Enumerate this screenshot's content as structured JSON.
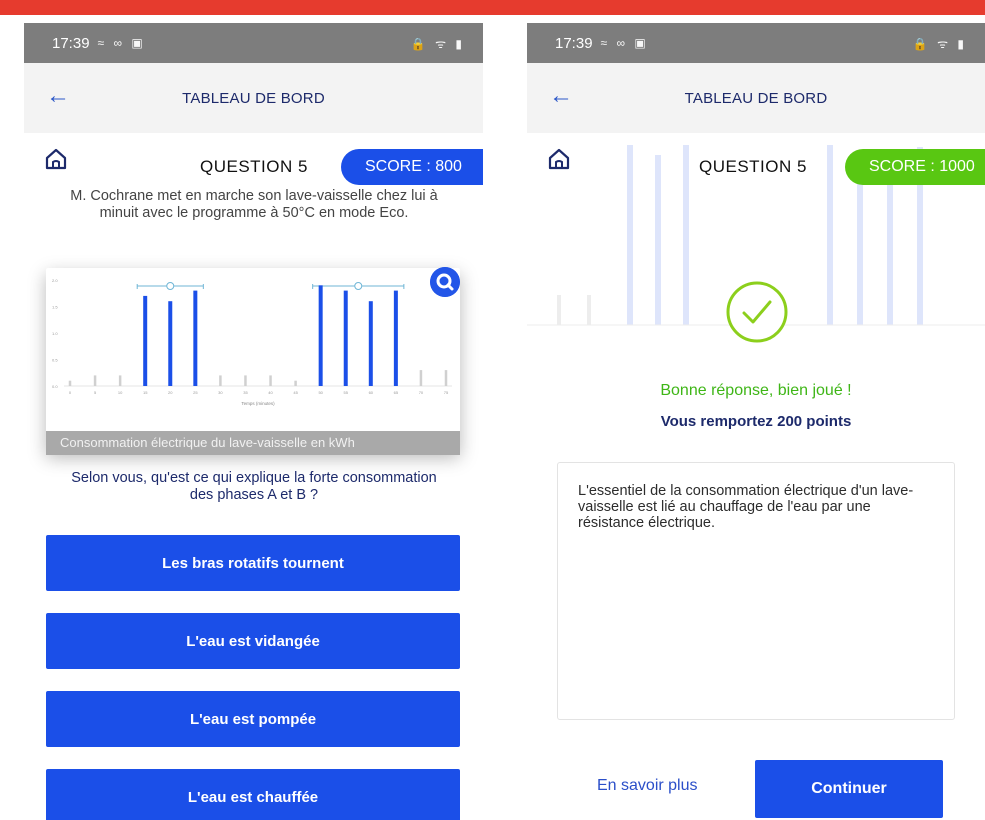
{
  "colors": {
    "top_bar": "#e63b2e",
    "primary": "#1b4fe8",
    "success": "#59c712",
    "title": "#1d2a6b"
  },
  "left": {
    "status": {
      "time": "17:39",
      "left_icons": "≈ ∞ ▣",
      "right_icons": "🔒 ᯤ ▮"
    },
    "appbar": {
      "title": "TABLEAU DE BORD",
      "back_icon": "arrow-left-icon"
    },
    "question_label": "QUESTION 5",
    "score": "SCORE : 800",
    "question_text": "M. Cochrane met en marche son lave-vaisselle chez lui à minuit avec le programme à 50°C en mode Eco.",
    "chart_caption": "Consommation électrique du lave-vaisselle en kWh",
    "prompt": "Selon vous, qu'est ce qui explique la forte consommation des phases A et B ?",
    "answers": [
      "Les bras rotatifs tournent",
      "L'eau est vidangée",
      "L'eau est pompée",
      "L'eau est chauffée"
    ]
  },
  "right": {
    "status": {
      "time": "17:39",
      "left_icons": "≈ ∞ ▣",
      "right_icons": "🔒 ᯤ ▮"
    },
    "appbar": {
      "title": "TABLEAU DE BORD",
      "back_icon": "arrow-left-icon"
    },
    "question_label": "QUESTION 5",
    "score": "SCORE : 1000",
    "feedback_title": "Bonne réponse, bien joué  !",
    "feedback_points": "Vous remportez 200 points",
    "explanation": "L'essentiel de la consommation électrique d'un lave-vaisselle est lié au chauffage de l'eau par une résistance électrique.",
    "learn_more": "En savoir plus",
    "continue": "Continuer"
  },
  "chart_data": {
    "type": "bar",
    "title": "Consommation électrique du lave-vaisselle en kWh",
    "xlabel": "Temps (minutes)",
    "ylabel": "",
    "categories": [
      "0",
      "5",
      "10",
      "15",
      "20",
      "25",
      "30",
      "35",
      "40",
      "45",
      "50",
      "55",
      "60",
      "65",
      "70",
      "75"
    ],
    "values": [
      0.1,
      0.2,
      0.2,
      1.7,
      1.6,
      1.8,
      0.2,
      0.2,
      0.2,
      0.1,
      1.9,
      1.8,
      1.6,
      1.8,
      0.3,
      0.3
    ],
    "ylim": [
      0,
      2.0
    ],
    "highlight_phases": [
      "A",
      "B"
    ]
  }
}
